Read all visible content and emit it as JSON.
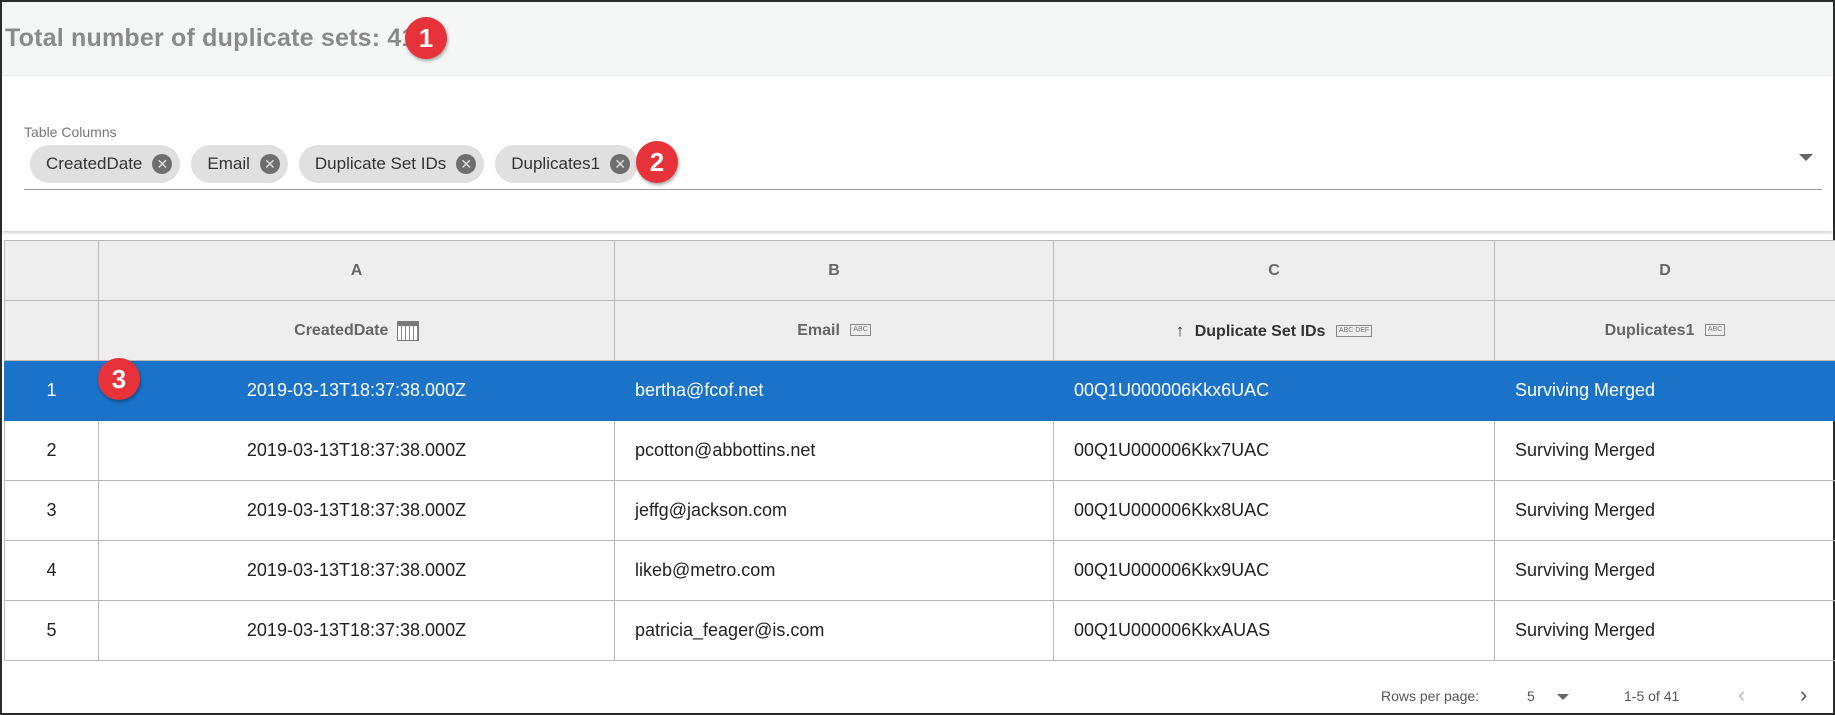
{
  "header": {
    "title": "Total number of duplicate sets: 41"
  },
  "callouts": [
    "1",
    "2",
    "3"
  ],
  "columns_panel": {
    "label": "Table Columns",
    "chips": [
      "CreatedDate",
      "Email",
      "Duplicate Set IDs",
      "Duplicates1"
    ],
    "icons": {
      "chip_remove": "close-circle-icon",
      "dropdown": "caret-down-icon"
    }
  },
  "table": {
    "letters": [
      "A",
      "B",
      "C",
      "D"
    ],
    "headers": [
      {
        "label": "CreatedDate",
        "type_icon": "calendar-icon"
      },
      {
        "label": "Email",
        "type_icon": "abc-icon",
        "type_text": "ABC"
      },
      {
        "label": "Duplicate Set IDs",
        "type_icon": "abc-def-icon",
        "type_text": "ABC DEF",
        "sort": "ascending"
      },
      {
        "label": "Duplicates1",
        "type_icon": "abc-icon",
        "type_text": "ABC"
      }
    ],
    "rows": [
      {
        "index": "1",
        "created": "2019-03-13T18:37:38.000Z",
        "email": "bertha@fcof.net",
        "set_id": "00Q1U000006Kkx6UAC",
        "dup": "Surviving Merged",
        "selected": true
      },
      {
        "index": "2",
        "created": "2019-03-13T18:37:38.000Z",
        "email": "pcotton@abbottins.net",
        "set_id": "00Q1U000006Kkx7UAC",
        "dup": "Surviving Merged",
        "selected": false
      },
      {
        "index": "3",
        "created": "2019-03-13T18:37:38.000Z",
        "email": "jeffg@jackson.com",
        "set_id": "00Q1U000006Kkx8UAC",
        "dup": "Surviving Merged",
        "selected": false
      },
      {
        "index": "4",
        "created": "2019-03-13T18:37:38.000Z",
        "email": "likeb@metro.com",
        "set_id": "00Q1U000006Kkx9UAC",
        "dup": "Surviving Merged",
        "selected": false
      },
      {
        "index": "5",
        "created": "2019-03-13T18:37:38.000Z",
        "email": "patricia_feager@is.com",
        "set_id": "00Q1U000006KkxAUAS",
        "dup": "Surviving Merged",
        "selected": false
      }
    ],
    "colors": {
      "selected_row": "#1a72c9",
      "callout": "#e8323a"
    }
  },
  "pagination": {
    "rows_per_page_label": "Rows per page:",
    "rows_per_page_value": "5",
    "range": "1-5 of 41"
  }
}
